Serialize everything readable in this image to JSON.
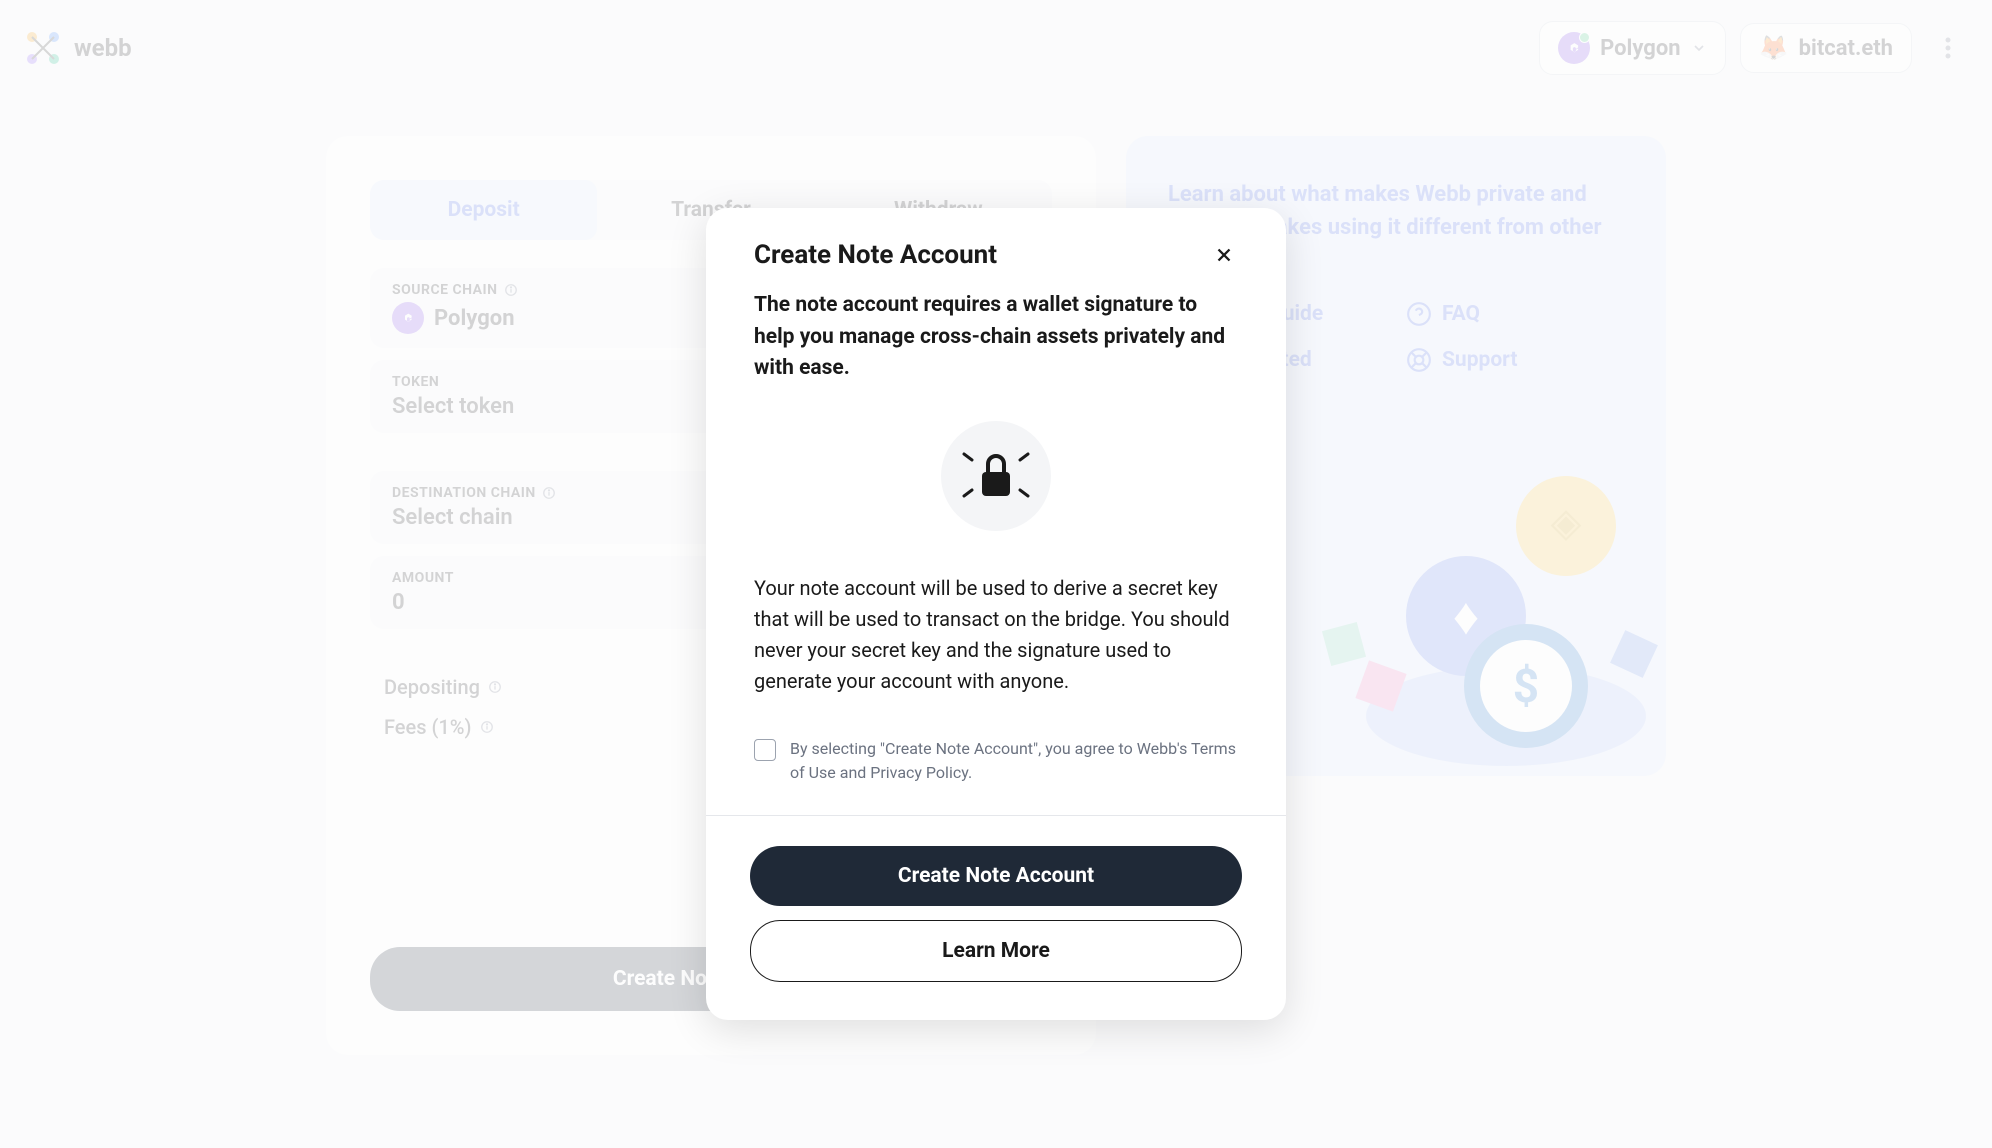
{
  "header": {
    "logo_text": "webb",
    "chain": "Polygon",
    "wallet": "bitcat.eth"
  },
  "tabs": {
    "deposit": "Deposit",
    "transfer": "Transfer",
    "withdraw": "Withdraw"
  },
  "form": {
    "source_chain_label": "SOURCE CHAIN",
    "source_chain_value": "Polygon",
    "token_label": "TOKEN",
    "token_value": "Select token",
    "dest_chain_label": "DESTINATION CHAIN",
    "dest_chain_value": "Select chain",
    "amount_label": "AMOUNT",
    "amount_value": "0"
  },
  "summary": {
    "depositing_label": "Depositing",
    "depositing_value": "--",
    "fees_label": "Fees (1%)",
    "fees_value": "--"
  },
  "cta_button": "Create Note Account",
  "info_panel": {
    "title": "Learn about what makes Webb private and how this makes using it different from other bridges.",
    "links": {
      "usage_guide": "Usage Guide",
      "faq": "FAQ",
      "get_started": "Get Started",
      "support": "Support"
    }
  },
  "modal": {
    "title": "Create Note Account",
    "intro": "The note account requires a wallet signature to help you manage cross-chain assets privately and with ease.",
    "description": "Your note account will be used to derive a secret key that will be used to transact on the bridge. You should never your secret key and the signature used to generate your account with anyone.",
    "checkbox_text": "By selecting \"Create Note Account\", you agree to Webb's Terms of Use and Privacy Policy.",
    "primary_button": "Create Note Account",
    "secondary_button": "Learn More"
  }
}
